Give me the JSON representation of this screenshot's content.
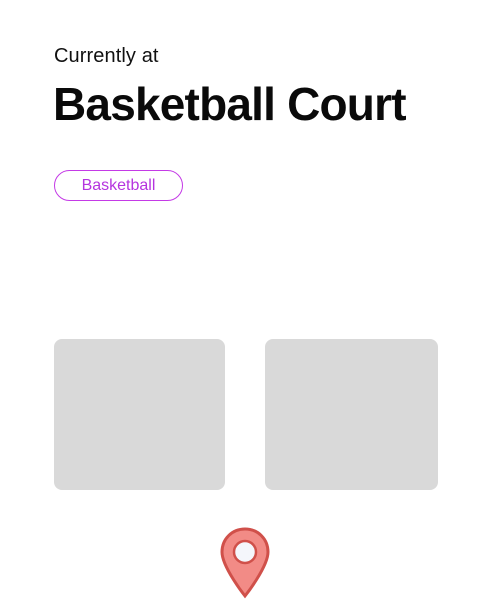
{
  "header": {
    "subtitle": "Currently at",
    "title": "Basketball Court"
  },
  "tags": [
    {
      "label": "Basketball"
    }
  ],
  "cards": [
    {
      "name": "left"
    },
    {
      "name": "right"
    }
  ],
  "icons": {
    "location": "map-pin-icon"
  },
  "colors": {
    "tag_accent": "#c43ae6",
    "card_placeholder": "#d9d9d9",
    "pin_fill": "#f28b86",
    "pin_stroke": "#d0504a"
  }
}
